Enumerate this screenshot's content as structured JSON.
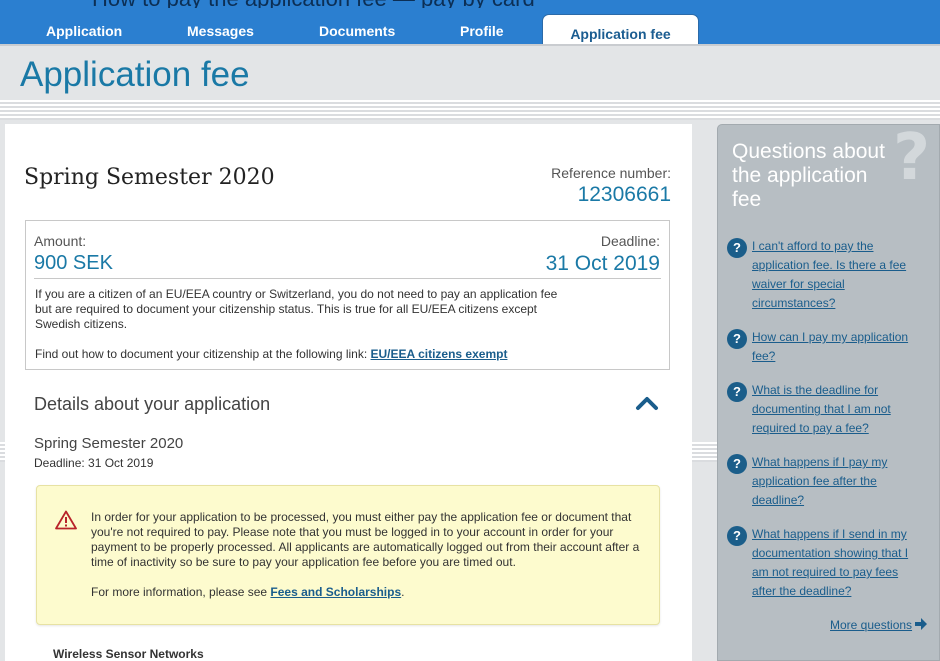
{
  "nav": {
    "tabs": [
      {
        "label": "Application"
      },
      {
        "label": "Messages"
      },
      {
        "label": "Documents"
      },
      {
        "label": "Profile"
      },
      {
        "label": "Application fee",
        "active": true
      }
    ],
    "clipped_header_text": "How to pay the application fee — pay by card"
  },
  "page": {
    "title": "Application fee"
  },
  "fee": {
    "semester": "Spring Semester 2020",
    "reference_label": "Reference number:",
    "reference_number": "12306661",
    "amount_label": "Amount:",
    "amount_value": "900 SEK",
    "deadline_label": "Deadline:",
    "deadline_value": "31 Oct 2019",
    "info_text": "If you are a citizen of an EU/EEA country or Switzerland, you do not need to pay an application fee but are required to document your citizenship status. This is true for all EU/EEA citizens except Swedish citizens.",
    "link_prefix": "Find out how to document your citizenship at the following link: ",
    "link_label": "EU/EEA citizens exempt"
  },
  "details": {
    "title": "Details about your application",
    "semester": "Spring Semester 2020",
    "deadline": "Deadline: 31 Oct 2019",
    "warning_text": "In order for your application to be processed, you must either pay the application fee or document that you're not required to pay. Please note that you must be logged in to your account in order for your payment to be properly processed. All applicants are automatically logged out from their account after a time of inactivity so be sure to pay your application fee before you are timed out.",
    "more_info_prefix": "For more information, please see ",
    "more_info_link": "Fees and Scholarships",
    "more_info_suffix": ".",
    "course_name": "Wireless Sensor Networks"
  },
  "sidebar": {
    "title": "Questions about the application fee",
    "q_icon_glyph": "?",
    "big_q_glyph": "?",
    "questions": [
      "I can't afford to pay the application fee. Is there a fee waiver for special circumstances?",
      "How can I pay my application fee?",
      "What is the deadline for documenting that I am not required to pay a fee?",
      "What happens if I pay my application fee after the deadline?",
      "What happens if I send in my documentation showing that I am not required to pay fees after the deadline?"
    ],
    "more_label": "More questions"
  },
  "colors": {
    "brand_blue": "#2b7fd0",
    "title_teal": "#1a79a6",
    "link_blue": "#1a5d8c",
    "warning_bg": "#fdfbce",
    "warning_icon": "#b8232a",
    "sidebar_bg": "#b7bec3"
  },
  "icons": [
    "warning-triangle-icon",
    "chevron-up-icon",
    "question-circle-icon",
    "arrow-right-icon",
    "question-mark-icon"
  ]
}
